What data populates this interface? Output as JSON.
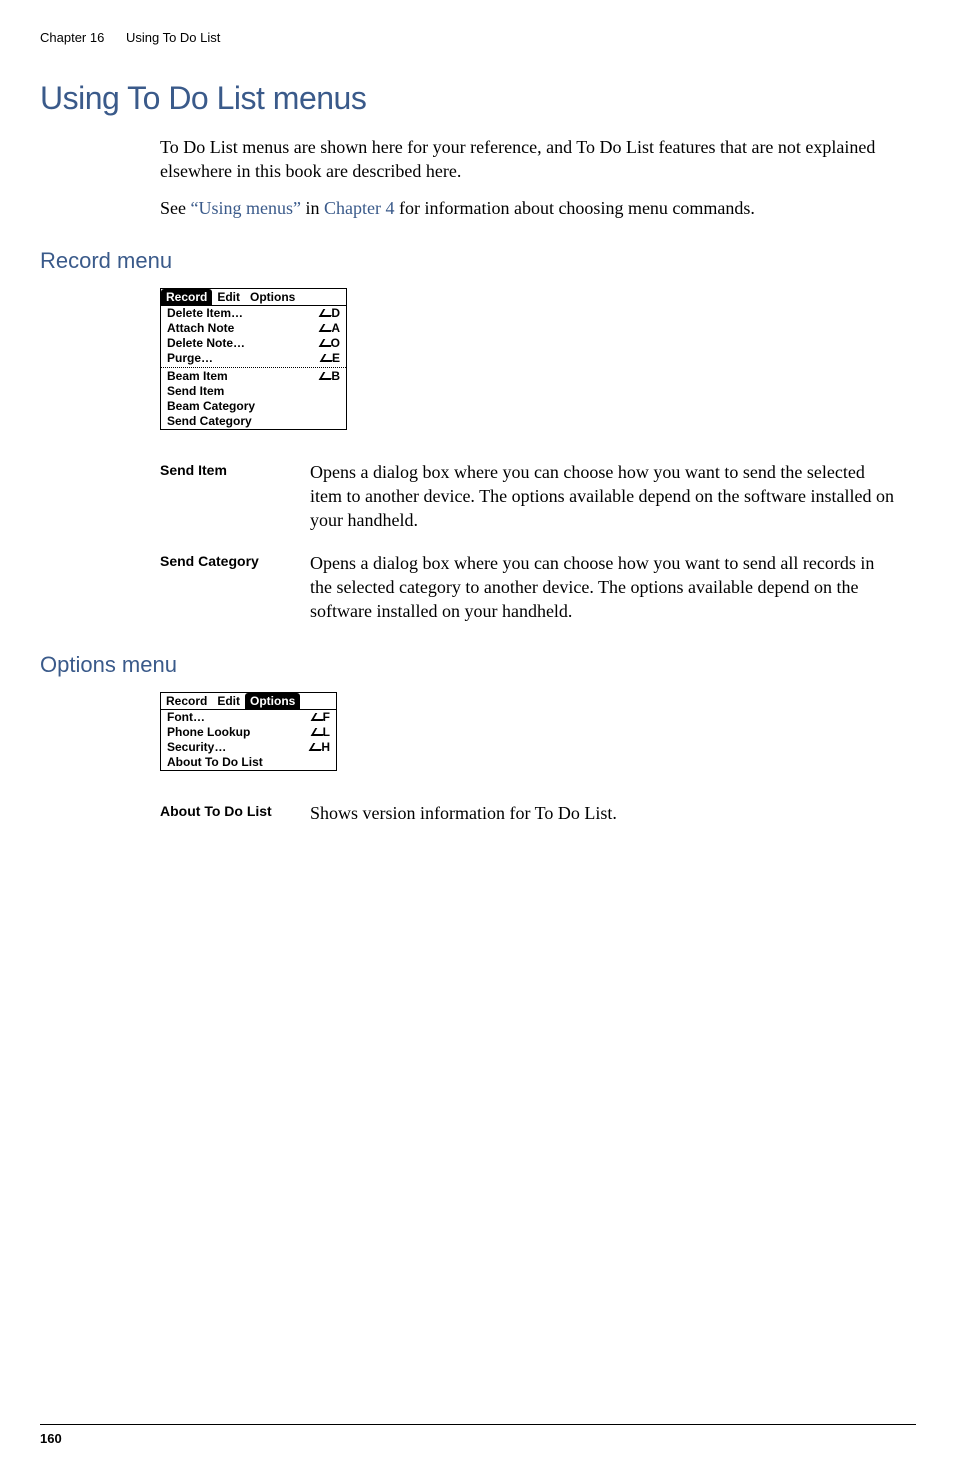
{
  "header": {
    "chapter": "Chapter 16",
    "title": "Using To Do List"
  },
  "h1": "Using To Do List menus",
  "intro1": "To Do List menus are shown here for your reference, and To Do List features that are not explained elsewhere in this book are described here.",
  "intro2_pre": "See ",
  "intro2_link1": "“Using menus”",
  "intro2_mid": " in ",
  "intro2_link2": "Chapter 4",
  "intro2_post": " for information about choosing menu commands.",
  "record": {
    "heading": "Record menu",
    "menubar": [
      "Record",
      "Edit",
      "Options"
    ],
    "menubar_selected": 0,
    "items": [
      {
        "label": "Delete Item…",
        "shortcut": "D"
      },
      {
        "label": "Attach Note",
        "shortcut": "A"
      },
      {
        "label": "Delete Note…",
        "shortcut": "O"
      },
      {
        "label": "Purge…",
        "shortcut": "E"
      },
      {
        "sep": true
      },
      {
        "label": "Beam Item",
        "shortcut": "B"
      },
      {
        "label": "Send Item",
        "shortcut": ""
      },
      {
        "label": "Beam Category",
        "shortcut": ""
      },
      {
        "label": "Send Category",
        "shortcut": ""
      }
    ],
    "defs": [
      {
        "term": "Send Item",
        "desc": "Opens a dialog box where you can choose how you want to send the selected item to another device. The options available depend on the software installed on your handheld."
      },
      {
        "term": "Send Category",
        "desc": "Opens a dialog box where you can choose how you want to send all records in the selected category to another device. The options available depend on the software installed on your handheld."
      }
    ]
  },
  "options": {
    "heading": "Options menu",
    "menubar": [
      "Record",
      "Edit",
      "Options"
    ],
    "menubar_selected": 2,
    "items": [
      {
        "label": "Font…",
        "shortcut": "F"
      },
      {
        "label": "Phone Lookup",
        "shortcut": "L"
      },
      {
        "label": "Security…",
        "shortcut": "H"
      },
      {
        "label": "About To Do List",
        "shortcut": ""
      }
    ],
    "defs": [
      {
        "term": "About To Do List",
        "desc": "Shows version information for To Do List."
      }
    ]
  },
  "page_number": "160"
}
